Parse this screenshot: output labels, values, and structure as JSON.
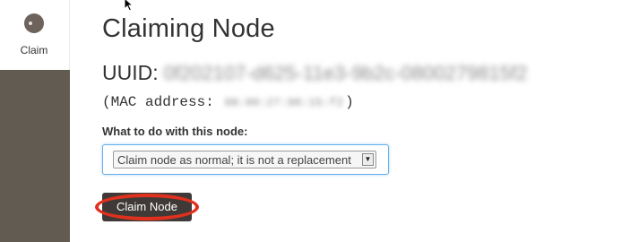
{
  "sidebar": {
    "items": [
      {
        "label": "Claim",
        "icon": "claim-icon"
      }
    ],
    "dark_panel_color": "#625b52"
  },
  "main": {
    "title": "Claiming Node",
    "uuid_label": "UUID:",
    "uuid_value": "0f202107-d625-11e3-9b2c-0800279815f2",
    "mac_prefix": "(MAC address:",
    "mac_value": "08:00:27:98:15:f2",
    "mac_suffix": ")",
    "action_label": "What to do with this node:",
    "action_select": {
      "selected": "Claim node as normal; it is not a replacement"
    },
    "claim_button_label": "Claim Node"
  },
  "colors": {
    "highlight": "#e0301e",
    "focus_border": "#66afe9",
    "button_bg": "#3f3a37"
  }
}
